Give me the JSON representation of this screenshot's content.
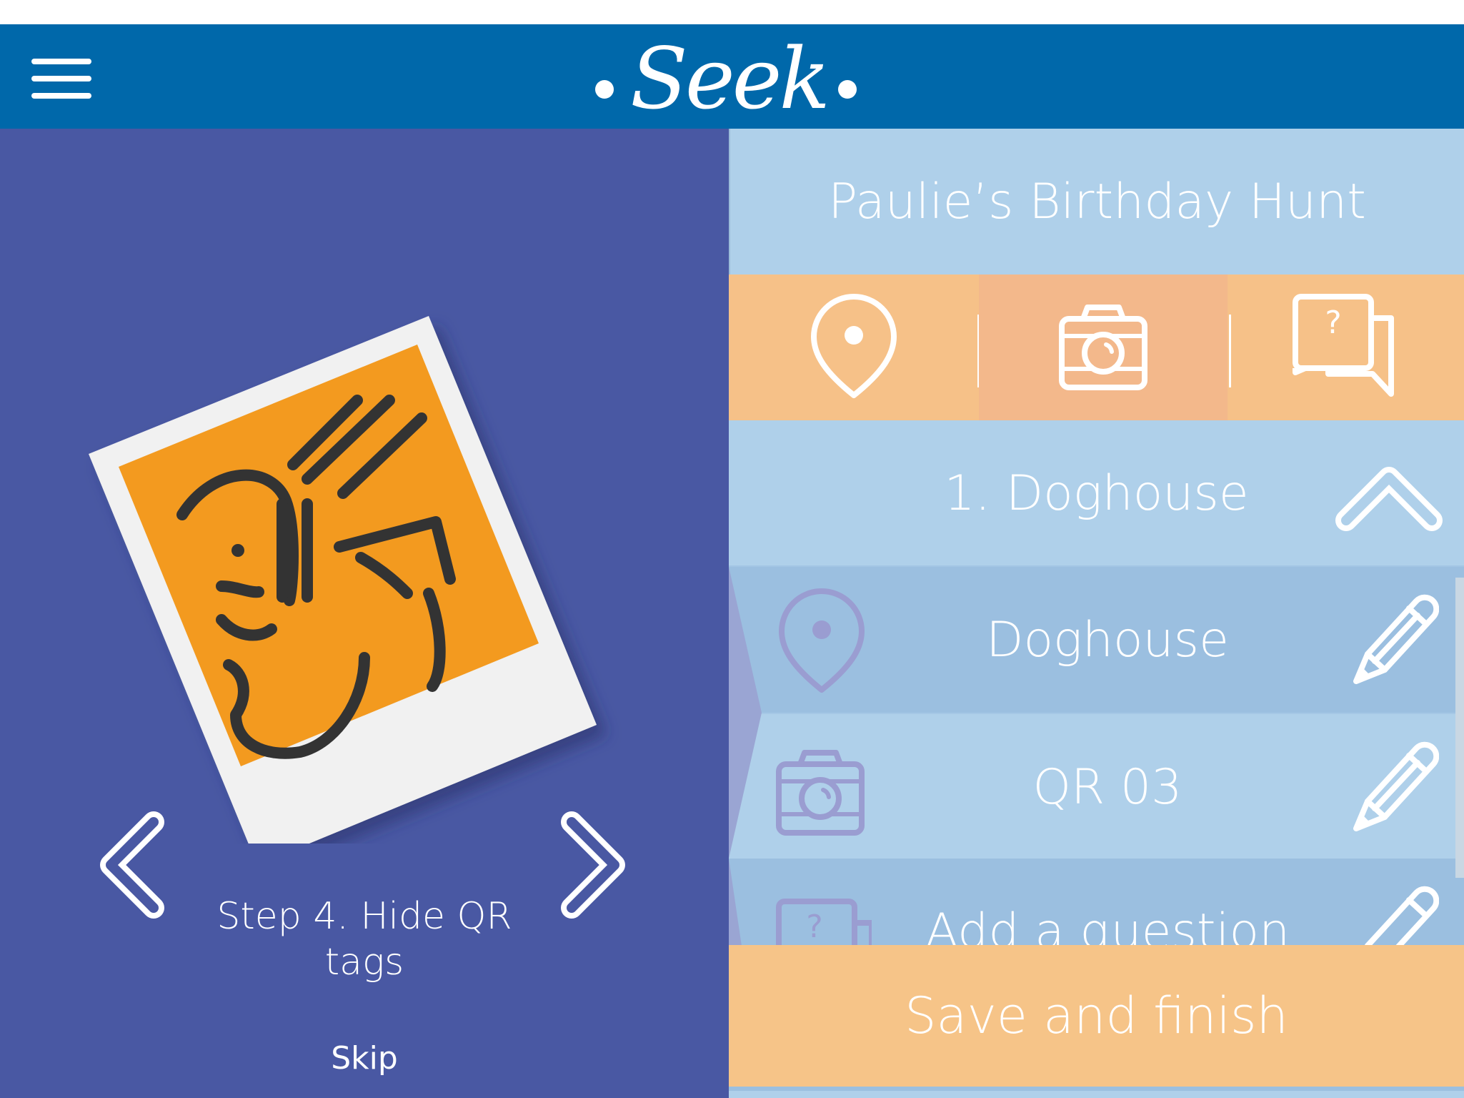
{
  "header": {
    "logo_text": "Seek"
  },
  "left_panel": {
    "step_text": "Step 4. Hide QR tags",
    "skip_label": "Skip"
  },
  "right_panel": {
    "hunt_title": "Paulie’s Birthday Hunt",
    "type_tabs": [
      {
        "icon": "location-pin-icon"
      },
      {
        "icon": "camera-icon",
        "selected": true
      },
      {
        "icon": "question-chat-icon"
      }
    ],
    "section": {
      "title": "1. Doghouse"
    },
    "items": [
      {
        "icon": "location-pin-icon",
        "label": "Doghouse"
      },
      {
        "icon": "camera-icon",
        "label": "QR 03"
      },
      {
        "icon": "question-chat-icon",
        "label": "Add a question"
      }
    ],
    "save_label": "Save and finish"
  },
  "colors": {
    "header_bg": "#0068aa",
    "left_bg": "#4958a3",
    "right_bg": "#afd0ea",
    "row_dark": "#9bbfe0",
    "orange": "#f6c188",
    "polaroid_orange": "#f39a1f"
  }
}
